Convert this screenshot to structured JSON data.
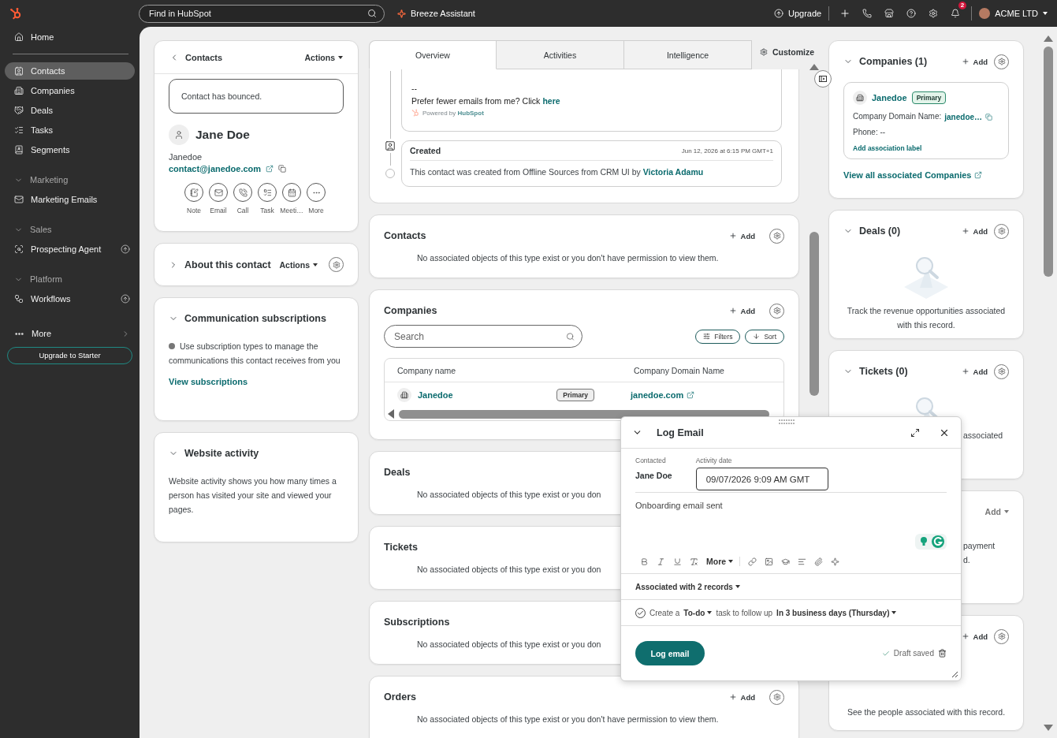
{
  "topbar": {
    "search": {
      "placeholder": "Find in HubSpot"
    },
    "assistant": "Breeze Assistant",
    "upgrade": "Upgrade",
    "notification_count": "2",
    "account": "ACME LTD"
  },
  "sidebar": {
    "items": [
      {
        "kind": "link",
        "label": "Home",
        "selected": false,
        "upgrade": false
      },
      {
        "kind": "divider"
      },
      {
        "kind": "link",
        "label": "Contacts",
        "selected": true,
        "upgrade": false
      },
      {
        "kind": "link",
        "label": "Companies",
        "selected": false,
        "upgrade": false
      },
      {
        "kind": "link",
        "label": "Deals",
        "selected": false,
        "upgrade": false
      },
      {
        "kind": "link",
        "label": "Tasks",
        "selected": false,
        "upgrade": false
      },
      {
        "kind": "link",
        "label": "Segments",
        "selected": false,
        "upgrade": false
      },
      {
        "kind": "section",
        "label": "Marketing",
        "expanded": true
      },
      {
        "kind": "link",
        "label": "Marketing Emails",
        "selected": false,
        "upgrade": false
      },
      {
        "kind": "section",
        "label": "Sales",
        "expanded": true
      },
      {
        "kind": "link",
        "label": "Prospecting Agent",
        "selected": false,
        "upgrade": true
      },
      {
        "kind": "section",
        "label": "Platform",
        "expanded": true
      },
      {
        "kind": "link",
        "label": "Workflows",
        "selected": false,
        "upgrade": true
      },
      {
        "kind": "more",
        "label": "More"
      },
      {
        "kind": "button",
        "label": "Upgrade to Starter"
      }
    ]
  },
  "record": {
    "back_label": "Contacts",
    "actions": "Actions",
    "alert": "Contact has bounced.",
    "name": "Jane Doe",
    "company": "Janedoe",
    "email": "contact@janedoe.com",
    "quick_actions": [
      "Note",
      "Email",
      "Call",
      "Task",
      "Meeti…",
      "More"
    ]
  },
  "about": {
    "title": "About this contact",
    "actions": "Actions",
    "expanded": false
  },
  "subscriptions": {
    "title": "Communication subscriptions",
    "expanded": true,
    "text": "Use subscription types to manage the communications this contact receives from you",
    "link": "View subscriptions"
  },
  "website_activity": {
    "title": "Website activity",
    "expanded": true,
    "text": "Website activity shows you how many times a person has visited your site and viewed your pages."
  },
  "tabs": [
    {
      "label": "Overview",
      "selected": true
    },
    {
      "label": "Activities",
      "selected": false
    },
    {
      "label": "Intelligence",
      "selected": false
    }
  ],
  "customize": "Customize",
  "timeline": {
    "email_lines": [
      "--"
    ],
    "optout_text": "Prefer fewer emails from me? Click",
    "optout_link": "here",
    "powered": "Powered by **HubSpot**",
    "created": {
      "title": "Created",
      "time": "Jun 12, 2026 at 6:15 PM GMT+1",
      "text": "This contact was created from Offline Sources from CRM UI by",
      "author": "Victoria Adamu"
    }
  },
  "middle_cards": [
    {
      "kind": "empty",
      "title": "Contacts",
      "add": "Add",
      "message": "No associated objects of this type exist or you don't have permission to view them."
    },
    {
      "kind": "table",
      "title": "Companies",
      "add": "Add",
      "search": {
        "placeholder": "Search"
      },
      "filters": "Filters",
      "sort": "Sort",
      "columns": [
        "Company name",
        "Company Domain Name"
      ],
      "rows": [
        {
          "name": "Janedoe",
          "badge": "Primary",
          "domain": "janedoe.com"
        }
      ]
    },
    {
      "kind": "empty",
      "title": "Deals",
      "message": "No associated objects of this type exist or you don"
    },
    {
      "kind": "empty",
      "title": "Tickets",
      "message": "No associated objects of this type exist or you don"
    },
    {
      "kind": "empty",
      "title": "Subscriptions",
      "message": "No associated objects of this type exist or you don"
    },
    {
      "kind": "empty",
      "title": "Orders",
      "add": "Add",
      "message": "No associated objects of this type exist or you don't have permission to view them."
    }
  ],
  "right_cards": [
    {
      "kind": "companies",
      "title": "Companies (1)",
      "expanded": true,
      "add": "Add",
      "company": {
        "name": "Janedoe",
        "badge": "Primary",
        "domain_label": "Company Domain Name:",
        "domain": "janedoe…",
        "phone": "Phone: --",
        "label_link": "Add association label"
      },
      "view_all": "View all associated Companies"
    },
    {
      "kind": "empty",
      "title": "Deals (0)",
      "expanded": true,
      "add": "Add",
      "illustration": true,
      "message": "Track the revenue opportunities associated with this record."
    },
    {
      "kind": "partial",
      "title": "Tickets (0)",
      "expanded": true,
      "add": "Add",
      "illustration": true,
      "fragments": [
        "associated"
      ]
    },
    {
      "kind": "partial",
      "add_menu": "Add",
      "fragments": [
        "payment",
        "d."
      ]
    },
    {
      "kind": "partial",
      "add": "Add",
      "message": "See the people associated with this record."
    }
  ],
  "log_email": {
    "title": "Log Email",
    "contacted_label": "Contacted",
    "contacted": "Jane Doe",
    "date_label": "Activity date",
    "date": "09/07/2026 9:09 AM GMT",
    "body": "Onboarding email sent",
    "more": "More",
    "associated": "Associated with 2 records",
    "task": {
      "checked": true,
      "prefix": "Create a",
      "type": "To-do",
      "middle": "task to follow up",
      "due": "In 3 business days (Thursday)"
    },
    "submit": "Log email",
    "draft_status": "Draft saved"
  }
}
